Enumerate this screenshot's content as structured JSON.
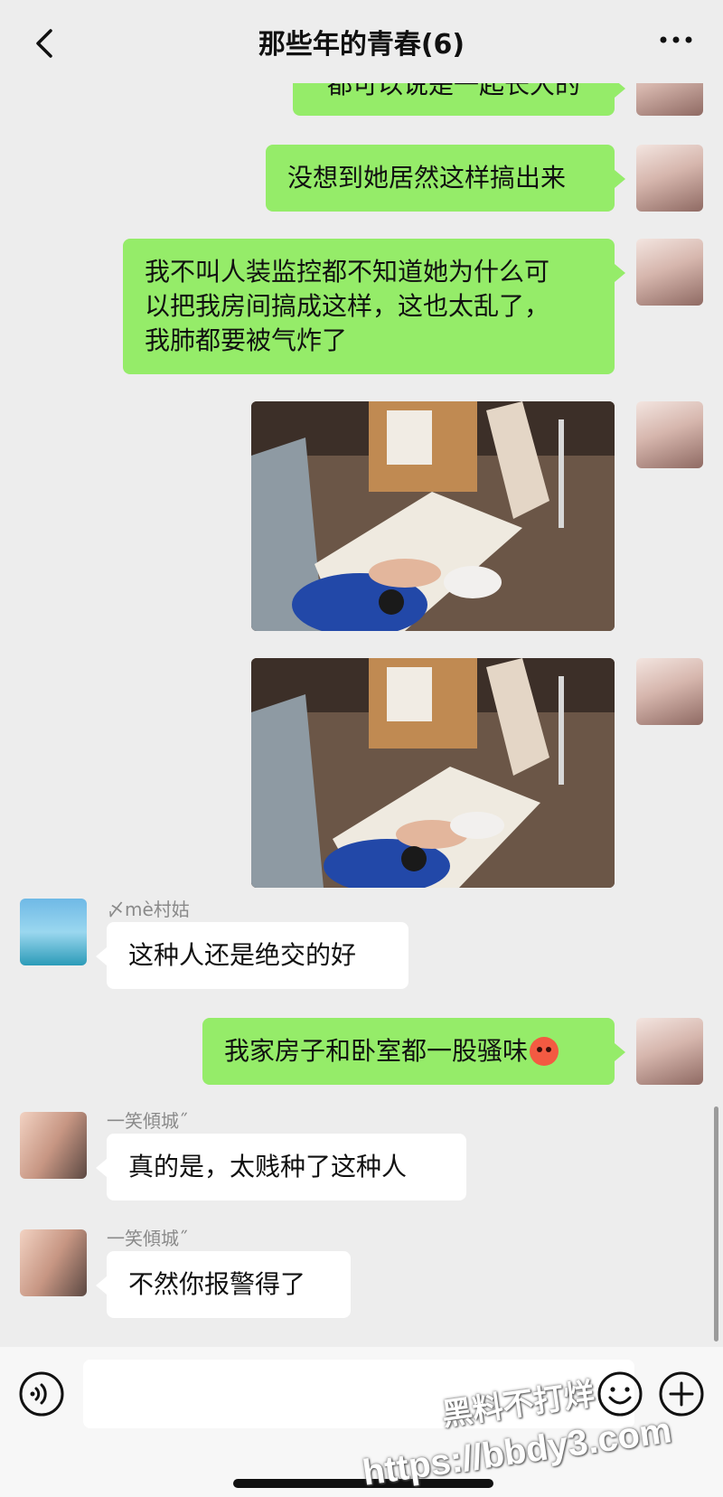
{
  "header": {
    "title": "那些年的青春(6)",
    "back_icon": "chevron-left-icon",
    "more_icon": "more-dots-icon"
  },
  "messages": [
    {
      "side": "out",
      "type": "text",
      "text": "都可以说是一起长大的"
    },
    {
      "side": "out",
      "type": "text",
      "text": "没想到她居然这样搞出来"
    },
    {
      "side": "out",
      "type": "text",
      "lines": [
        "我不叫人装监控都不知道她为什么可",
        "以把我房间搞成这样，这也太乱了，",
        "我肺都要被气炸了"
      ]
    },
    {
      "side": "out",
      "type": "image"
    },
    {
      "side": "out",
      "type": "image"
    },
    {
      "side": "in",
      "type": "text",
      "sender": "〆mè村姑",
      "text": "这种人还是绝交的好"
    },
    {
      "side": "out",
      "type": "text",
      "text": "我家房子和卧室都一股骚味",
      "emoji": "angry-face-icon"
    },
    {
      "side": "in",
      "type": "text",
      "sender": "一笑傾城˝",
      "text": "真的是，太贱种了这种人"
    },
    {
      "side": "in",
      "type": "text",
      "sender": "一笑傾城˝",
      "text": "不然你报警得了"
    }
  ],
  "input_bar": {
    "voice_icon": "voice-icon",
    "emoji_icon": "emoji-icon",
    "plus_icon": "plus-icon"
  },
  "watermark": {
    "line1": "黑料不打烊",
    "line2": "https://bbdy3.com"
  },
  "colors": {
    "outgoing_bubble": "#95ec69",
    "incoming_bubble": "#ffffff",
    "background": "#ededed"
  }
}
